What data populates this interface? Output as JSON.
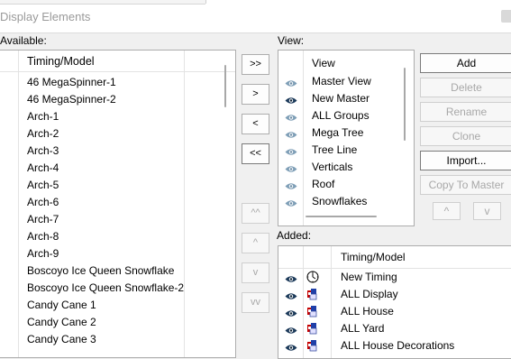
{
  "window": {
    "title": "Display Elements"
  },
  "available": {
    "label": "Available:",
    "header": "Timing/Model",
    "items": [
      "46 MegaSpinner-1",
      "46 MegaSpinner-2",
      "Arch-1",
      "Arch-2",
      "Arch-3",
      "Arch-4",
      "Arch-5",
      "Arch-6",
      "Arch-7",
      "Arch-8",
      "Arch-9",
      "Boscoyo Ice Queen Snowflake",
      "Boscoyo Ice Queen Snowflake-2",
      "Candy Cane 1",
      "Candy Cane 2",
      "Candy Cane 3"
    ]
  },
  "move_buttons": {
    "add_all": ">>",
    "add": ">",
    "remove": "<",
    "remove_all": "<<",
    "top": "^^",
    "up": "^",
    "down": "v",
    "bottom": "vv"
  },
  "view": {
    "label": "View:",
    "header": "View",
    "items": [
      {
        "name": "Master View",
        "eye": "light"
      },
      {
        "name": "New Master",
        "eye": "dark"
      },
      {
        "name": "ALL Groups",
        "eye": "light"
      },
      {
        "name": "Mega Tree",
        "eye": "light"
      },
      {
        "name": "Tree Line",
        "eye": "light"
      },
      {
        "name": "Verticals",
        "eye": "light"
      },
      {
        "name": "Roof",
        "eye": "light"
      },
      {
        "name": "Snowflakes",
        "eye": "light"
      }
    ]
  },
  "view_buttons": {
    "add": "Add",
    "delete": "Delete",
    "rename": "Rename",
    "clone": "Clone",
    "import": "Import...",
    "copy_to_master": "Copy To Master",
    "up": "^",
    "down": "v"
  },
  "added": {
    "label": "Added:",
    "header": "Timing/Model",
    "items": [
      {
        "name": "New Timing",
        "icon": "timing-clock"
      },
      {
        "name": "ALL Display",
        "icon": "model-group"
      },
      {
        "name": "ALL House",
        "icon": "model-group"
      },
      {
        "name": "ALL Yard",
        "icon": "model-group"
      },
      {
        "name": "ALL House Decorations",
        "icon": "model-group"
      }
    ]
  }
}
